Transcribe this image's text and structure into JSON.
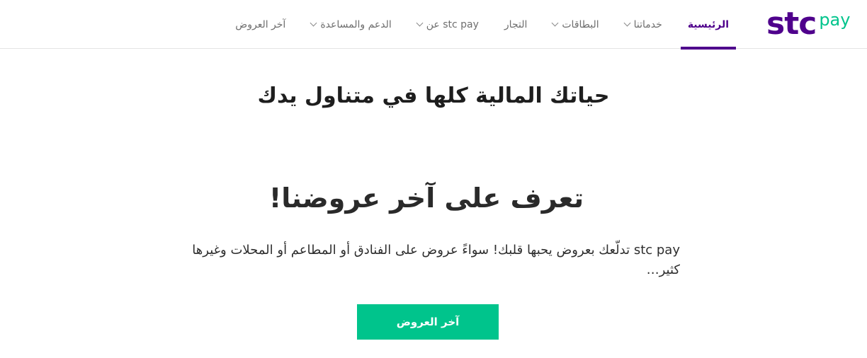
{
  "logo": {
    "primary": "stc",
    "secondary": "pay"
  },
  "nav": {
    "items": [
      {
        "label": "الرئيسية",
        "active": true,
        "dropdown": false
      },
      {
        "label": "خدماتنا",
        "active": false,
        "dropdown": true
      },
      {
        "label": "البطاقات",
        "active": false,
        "dropdown": true
      },
      {
        "label": "التجار",
        "active": false,
        "dropdown": false
      },
      {
        "label": "عن stc pay",
        "active": false,
        "dropdown": true
      },
      {
        "label": "الدعم والمساعدة",
        "active": false,
        "dropdown": true
      },
      {
        "label": "آخر العروض",
        "active": false,
        "dropdown": false
      }
    ]
  },
  "hero": {
    "title": "حياتك المالية كلها في متناول يدك"
  },
  "offers": {
    "title": "تعرف على آخر عروضنا!",
    "description": "stc pay تدلّعك بعروض يحبها قلبك! سواءً عروض على الفنادق أو المطاعم أو المحلات وغيرها كثير…",
    "button_label": "آخر العروض"
  },
  "colors": {
    "brand_purple": "#4f008c",
    "brand_green": "#00c48c"
  }
}
